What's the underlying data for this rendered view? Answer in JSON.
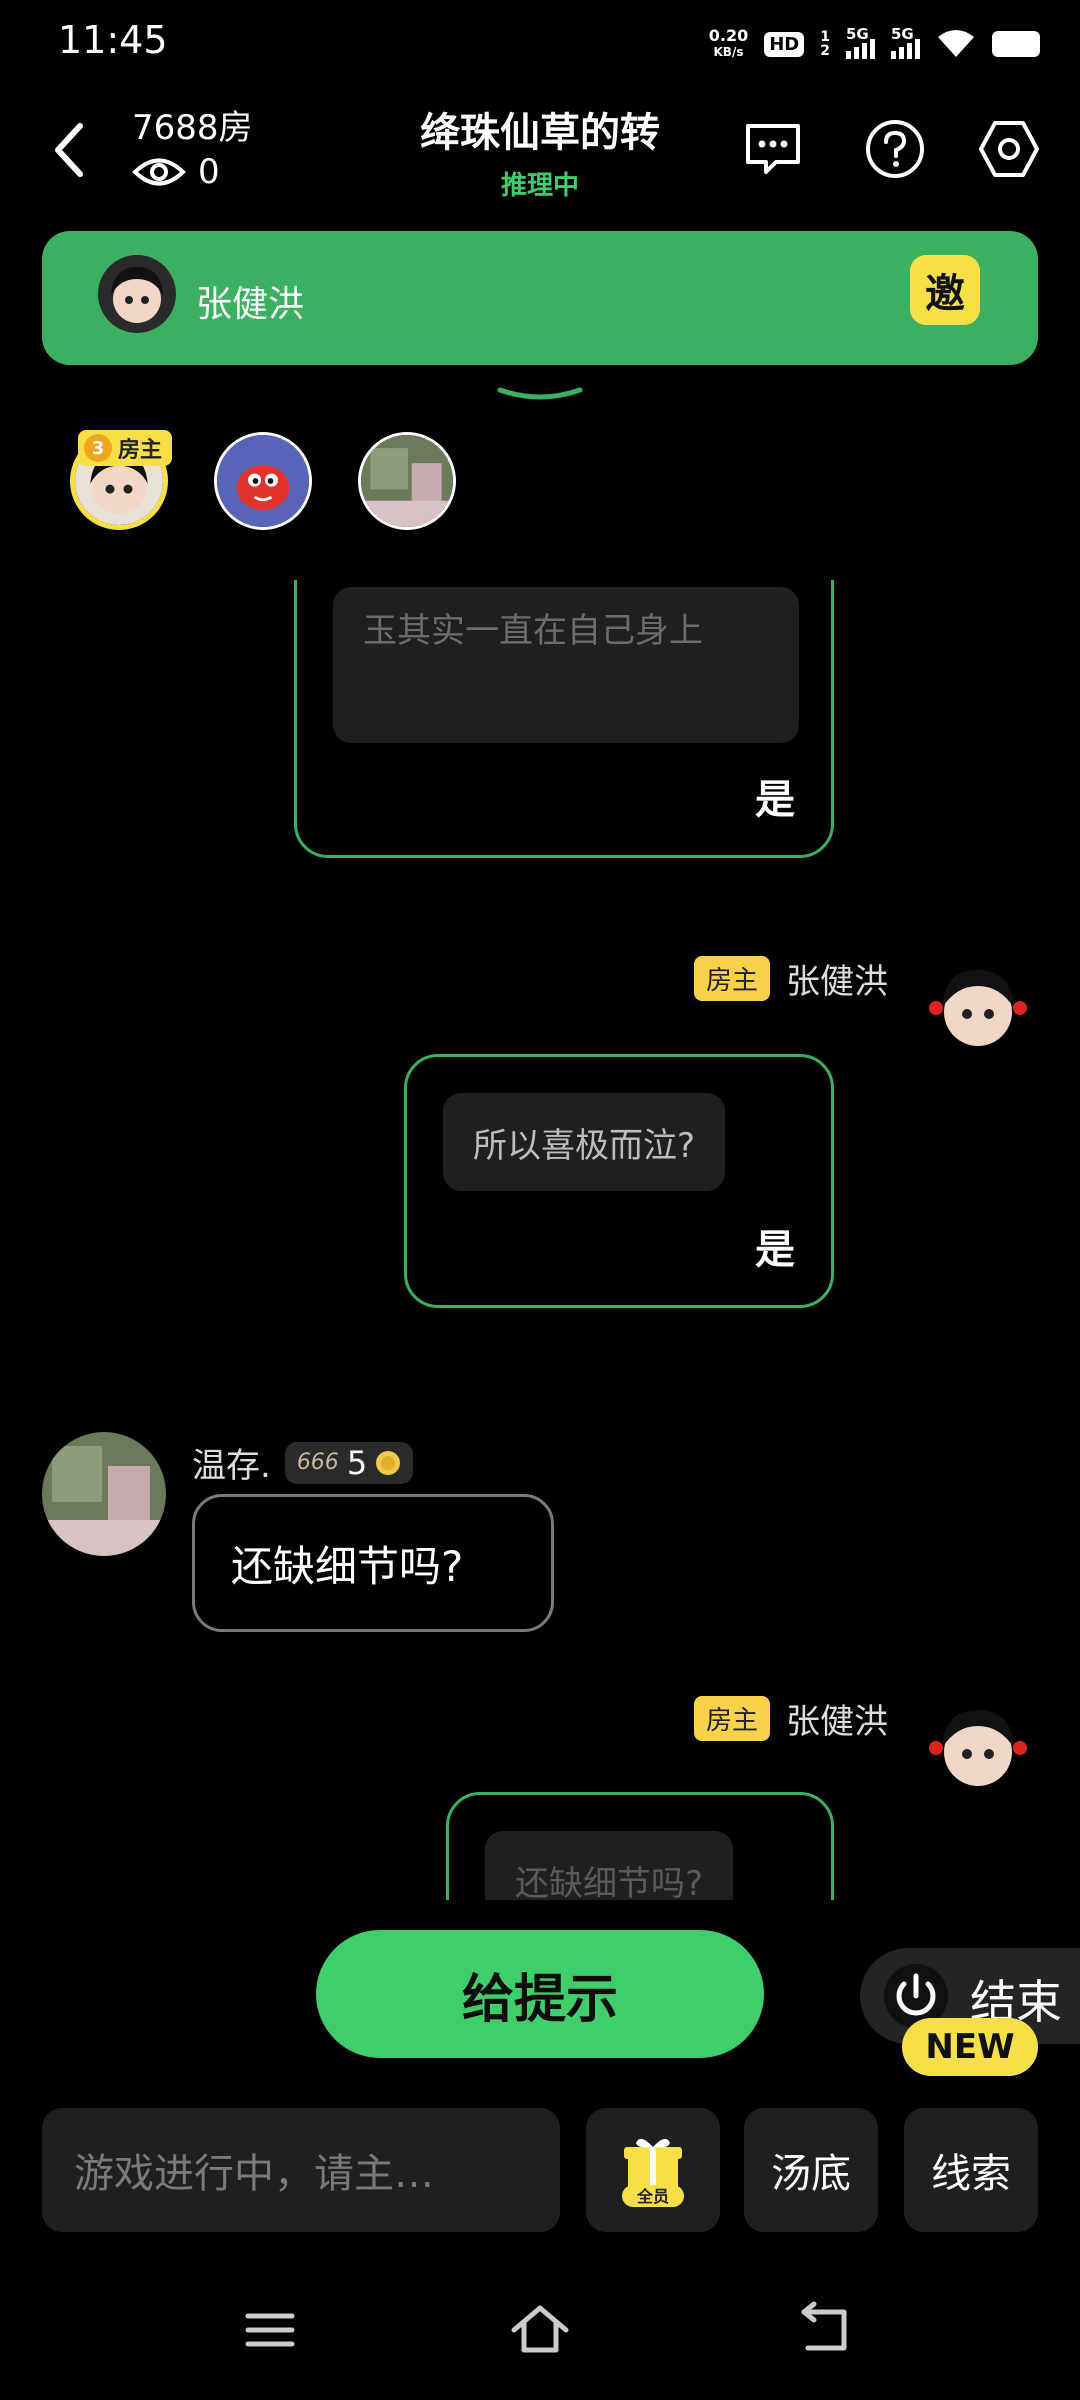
{
  "status": {
    "time": "11:45",
    "net_speed_value": "0.20",
    "net_speed_unit": "KB/s",
    "hd": "HD",
    "sim1": "5G",
    "sim2": "5G",
    "sim_sup_1": "1",
    "sim_sup_2": "2"
  },
  "header": {
    "room": "7688房",
    "viewers": "0",
    "title": "绛珠仙草的转",
    "subtitle": "推理中"
  },
  "host_bar": {
    "name": "张健洪",
    "invite_label": "邀"
  },
  "players": {
    "owner_badge_level": "3",
    "owner_badge_label": "房主"
  },
  "chat": {
    "msg1": {
      "text": "玉其实一直在自己身上",
      "answer": "是"
    },
    "msg2": {
      "tag": "房主",
      "sender": "张健洪",
      "question": "所以喜极而泣?",
      "answer": "是"
    },
    "msg3": {
      "sender": "温存.",
      "level_badge": "666",
      "level": "5",
      "text": "还缺细节吗?"
    },
    "msg4": {
      "tag": "房主",
      "sender": "张健洪",
      "question": "还缺细节吗?"
    }
  },
  "controls": {
    "hint_label": "给提示",
    "end_label": "结束",
    "new_label": "NEW",
    "input_placeholder": "游戏进行中，请主…",
    "gift_tag": "全员",
    "soup_label": "汤底",
    "clue_label": "线索"
  },
  "colors": {
    "accent_green": "#3bb061",
    "bright_green": "#3fce6c",
    "yellow": "#f7e047",
    "background": "#000000"
  }
}
